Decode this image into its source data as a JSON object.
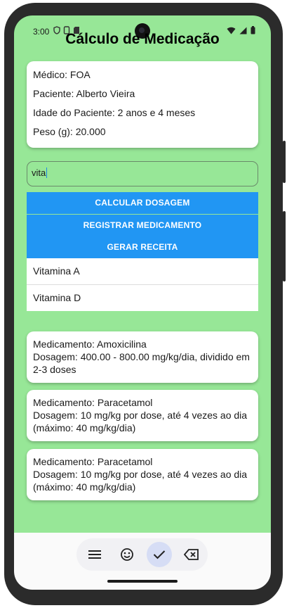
{
  "status_bar": {
    "time": "3:00"
  },
  "app": {
    "title": "Cálculo de Medicação"
  },
  "patient": {
    "doctor": "Médico: FOA",
    "name": "Paciente: Alberto Vieira",
    "age": "Idade do Paciente: 2 anos e 4 meses",
    "weight": "Peso (g): 20.000"
  },
  "search": {
    "value": "vita"
  },
  "buttons": {
    "calculate": "CALCULAR DOSAGEM",
    "register": "REGISTRAR MEDICAMENTO",
    "prescription": "GERAR RECEITA"
  },
  "suggestions": [
    "Vitamina A",
    "Vitamina D"
  ],
  "medications": [
    {
      "name": "Medicamento: Amoxicilina",
      "dosage": "Dosagem: 400.00 - 800.00 mg/kg/dia, dividido em 2-3 doses"
    },
    {
      "name": "Medicamento: Paracetamol",
      "dosage": "Dosagem: 10 mg/kg por dose, até 4 vezes ao dia (máximo: 40 mg/kg/dia)"
    },
    {
      "name": "Medicamento: Paracetamol",
      "dosage": "Dosagem: 10 mg/kg por dose, até 4 vezes ao dia (máximo: 40 mg/kg/dia)"
    }
  ],
  "keyboard_toolbar": {
    "icons": [
      "menu-icon",
      "emoji-icon",
      "check-icon",
      "backspace-icon"
    ]
  },
  "colors": {
    "app_background": "#97e797",
    "button_blue": "#2196f3",
    "active_key": "#d6ddf5"
  }
}
